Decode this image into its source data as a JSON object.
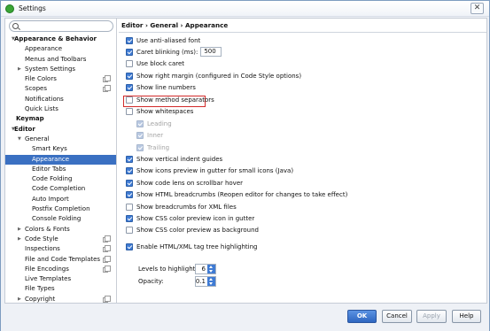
{
  "window": {
    "title": "Settings",
    "close_glyph": "✕"
  },
  "search": {
    "placeholder": "",
    "value": ""
  },
  "tree": [
    {
      "label": "Appearance & Behavior",
      "arrow": "▼",
      "bold": true
    },
    {
      "label": "Appearance"
    },
    {
      "label": "Menus and Toolbars"
    },
    {
      "label": "System Settings",
      "arrow": "▶"
    },
    {
      "label": "File Colors",
      "copy": true
    },
    {
      "label": "Scopes",
      "copy": true
    },
    {
      "label": "Notifications"
    },
    {
      "label": "Quick Lists"
    },
    {
      "label": "Keymap",
      "bold": true
    },
    {
      "label": "Editor",
      "arrow": "▼",
      "bold": true
    },
    {
      "label": "General",
      "arrow": "▼"
    },
    {
      "label": "Smart Keys"
    },
    {
      "label": "Appearance",
      "selected": true
    },
    {
      "label": "Editor Tabs"
    },
    {
      "label": "Code Folding"
    },
    {
      "label": "Code Completion"
    },
    {
      "label": "Auto Import"
    },
    {
      "label": "Postfix Completion"
    },
    {
      "label": "Console Folding"
    },
    {
      "label": "Colors & Fonts",
      "arrow": "▶"
    },
    {
      "label": "Code Style",
      "arrow": "▶",
      "copy": true
    },
    {
      "label": "Inspections",
      "copy": true
    },
    {
      "label": "File and Code Templates",
      "copy": true
    },
    {
      "label": "File Encodings",
      "copy": true
    },
    {
      "label": "Live Templates"
    },
    {
      "label": "File Types"
    },
    {
      "label": "Copyright",
      "arrow": "▶",
      "copy": true
    }
  ],
  "main": {
    "breadcrumb": "Editor › General › Appearance",
    "options": [
      {
        "label": "Use anti-aliased font",
        "checked": true
      },
      {
        "label": "Caret blinking (ms):",
        "checked": true,
        "field": "500"
      },
      {
        "label": "Use block caret",
        "checked": false
      },
      {
        "label": "Show right margin (configured in Code Style options)",
        "checked": true
      },
      {
        "label": "Show line numbers",
        "checked": true
      },
      {
        "label": "Show method separators",
        "checked": false
      },
      {
        "label": "Show whitespaces",
        "checked": false
      },
      {
        "label": "Leading",
        "checked": true,
        "disabled": true
      },
      {
        "label": "Inner",
        "checked": true,
        "disabled": true
      },
      {
        "label": "Trailing",
        "checked": true,
        "disabled": true
      },
      {
        "label": "Show vertical indent guides",
        "checked": true
      },
      {
        "label": "Show icons preview in gutter for small icons (Java)",
        "checked": true
      },
      {
        "label": "Show code lens on scrollbar hover",
        "checked": true
      },
      {
        "label": "Show HTML breadcrumbs (Reopen editor for changes to take effect)",
        "checked": true
      },
      {
        "label": "Show breadcrumbs for XML files",
        "checked": false
      },
      {
        "label": "Show CSS color preview icon in gutter",
        "checked": true
      },
      {
        "label": "Show CSS color preview as background",
        "checked": false
      },
      {
        "label": "Enable HTML/XML tag tree highlighting",
        "checked": true
      }
    ],
    "levels_label": "Levels to highlight:",
    "levels_value": "6",
    "opacity_label": "Opacity:",
    "opacity_value": "0.1"
  },
  "buttons": {
    "ok": "OK",
    "cancel": "Cancel",
    "apply": "Apply",
    "help": "Help"
  }
}
